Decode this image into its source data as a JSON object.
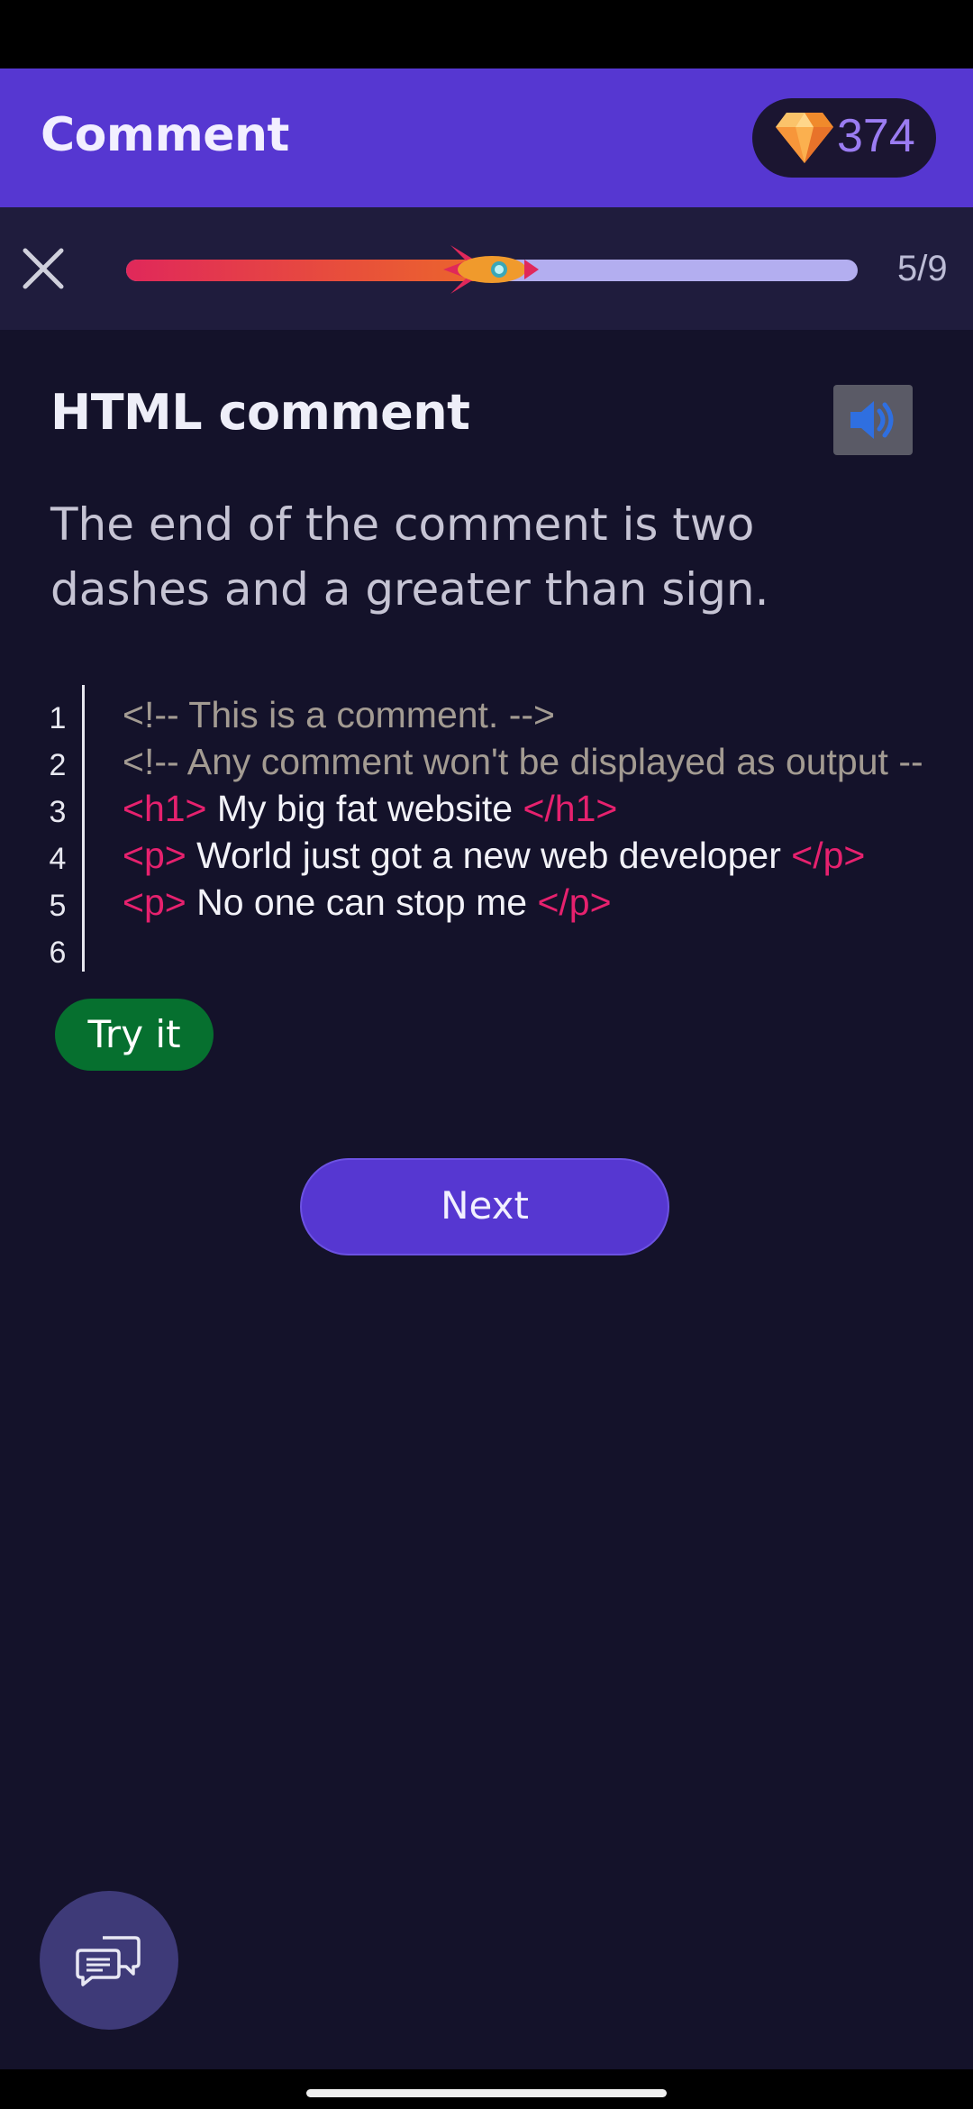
{
  "header": {
    "title": "Comment",
    "gems": "374"
  },
  "progress": {
    "step_text": "5/9",
    "current": 5,
    "total": 9,
    "fill_fraction": 0.52
  },
  "lesson": {
    "title": "HTML comment",
    "text": "The end of the comment is two dashes and a greater than sign."
  },
  "code": {
    "line_numbers": [
      "1",
      "2",
      "3",
      "4",
      "5",
      "6"
    ],
    "lines": [
      [
        "<!-- This is a comment. -->"
      ],
      [
        "<!-- Any comment won't be displayed as output -->"
      ],
      [
        "<h1>",
        " My big fat website ",
        "</h1>"
      ],
      [
        "<p>",
        " World just got a new web developer ",
        "</p>"
      ],
      [
        "<p>",
        " No one can stop me ",
        "</p>"
      ],
      []
    ]
  },
  "actions": {
    "try_label": "Try it",
    "next_label": "Next"
  },
  "icons": {
    "close": "close-icon",
    "gem": "gem-icon",
    "rocket": "rocket-icon",
    "audio": "speaker-icon",
    "chat": "chat-icon"
  },
  "colors": {
    "app_bar": "#5637d1",
    "background": "#14122a",
    "progress_fill": "#e0285a",
    "progress_track": "#b3aef0",
    "try_button": "#06702f",
    "comment_text": "#a39b92",
    "tag_text": "#e6216e"
  }
}
